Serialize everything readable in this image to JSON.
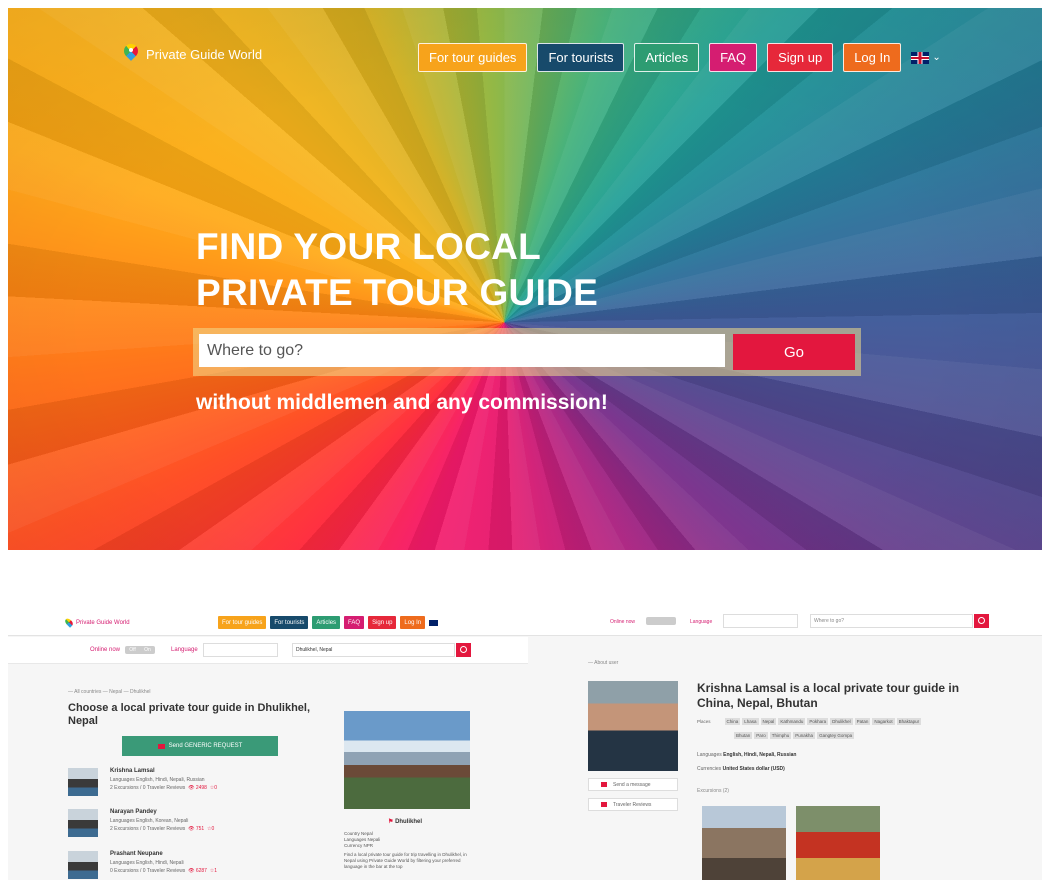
{
  "hero": {
    "logo_text": "Private Guide World",
    "nav": [
      {
        "label": "For tour guides",
        "color": "#f7a31b"
      },
      {
        "label": "For tourists",
        "color": "#174a6b"
      },
      {
        "label": "Articles",
        "color": "#2d9c72"
      },
      {
        "label": "FAQ",
        "color": "#d51d71"
      },
      {
        "label": "Sign up",
        "color": "#e6283a"
      },
      {
        "label": "Log In",
        "color": "#ee6b1d"
      }
    ],
    "language_icon": "uk-flag-icon",
    "headline_line1": "FIND YOUR LOCAL",
    "headline_line2": "PRIVATE TOUR GUIDE",
    "search_placeholder": "Where to go?",
    "go_label": "Go",
    "tagline": "without middlemen and any commission!"
  },
  "thumb_left": {
    "logo_text": "Private Guide World",
    "nav": [
      "For tour guides",
      "For tourists",
      "Articles",
      "FAQ",
      "Sign up",
      "Log In"
    ],
    "online_label": "Online now",
    "toggle_off": "Off",
    "toggle_on": "On",
    "language_label": "Language",
    "search_value": "Dhulikhel, Nepal",
    "crumbs": "— All countries — Nepal — Dhulikhel",
    "title": "Choose a local private tour guide in Dhulikhel, Nepal",
    "generic_button": "Send GENERIC REQUEST",
    "guides": [
      {
        "name": "Krishna Lamsal",
        "langs": "Languages English, Hindi, Nepali, Russian",
        "stats": "2 Excursions / 0 Traveler Reviews",
        "views": "2498",
        "stars": "0"
      },
      {
        "name": "Narayan Pandey",
        "langs": "Languages English, Korean, Nepali",
        "stats": "2 Excursions / 0 Traveler Reviews",
        "views": "751",
        "stars": "0"
      },
      {
        "name": "Prashant Neupane",
        "langs": "Languages English, Hindi, Nepali",
        "stats": "0 Excursions / 0 Traveler Reviews",
        "views": "6287",
        "stars": "1"
      }
    ],
    "place_name": "Dhulikhel",
    "place_info_country": "Country Nepal",
    "place_info_lang": "Languages Nepali",
    "place_info_currency": "Currency NPR",
    "place_desc": "Find a local private tour guide for trip travelling in Dhulikhel, in Nepal using Private Guide World by filtering your preferred language in the bar at the top"
  },
  "thumb_right": {
    "online_label": "Online now",
    "language_label": "Language",
    "search_placeholder": "Where to go?",
    "crumb": "— About user",
    "title": "Krishna Lamsal is a local private tour guide in China, Nepal, Bhutan",
    "places_label": "Places",
    "places_row1": [
      "China",
      "Lhasa",
      "Nepal",
      "Kathmandu",
      "Pokhara",
      "Dhulikhel",
      "Patan",
      "Nagarkot",
      "Bhaktapur"
    ],
    "places_row2": [
      "Bhutan",
      "Paro",
      "Thimphu",
      "Punakha",
      "Gangtey Gompa"
    ],
    "languages_label": "Languages",
    "languages_value": "English, Hindi, Nepali, Russian",
    "currencies_label": "Currencies",
    "currencies_value": "United States dollar (USD)",
    "excursions_label": "Excursions (2)",
    "send_message": "Send a message",
    "reviews": "Traveler Reviews"
  }
}
